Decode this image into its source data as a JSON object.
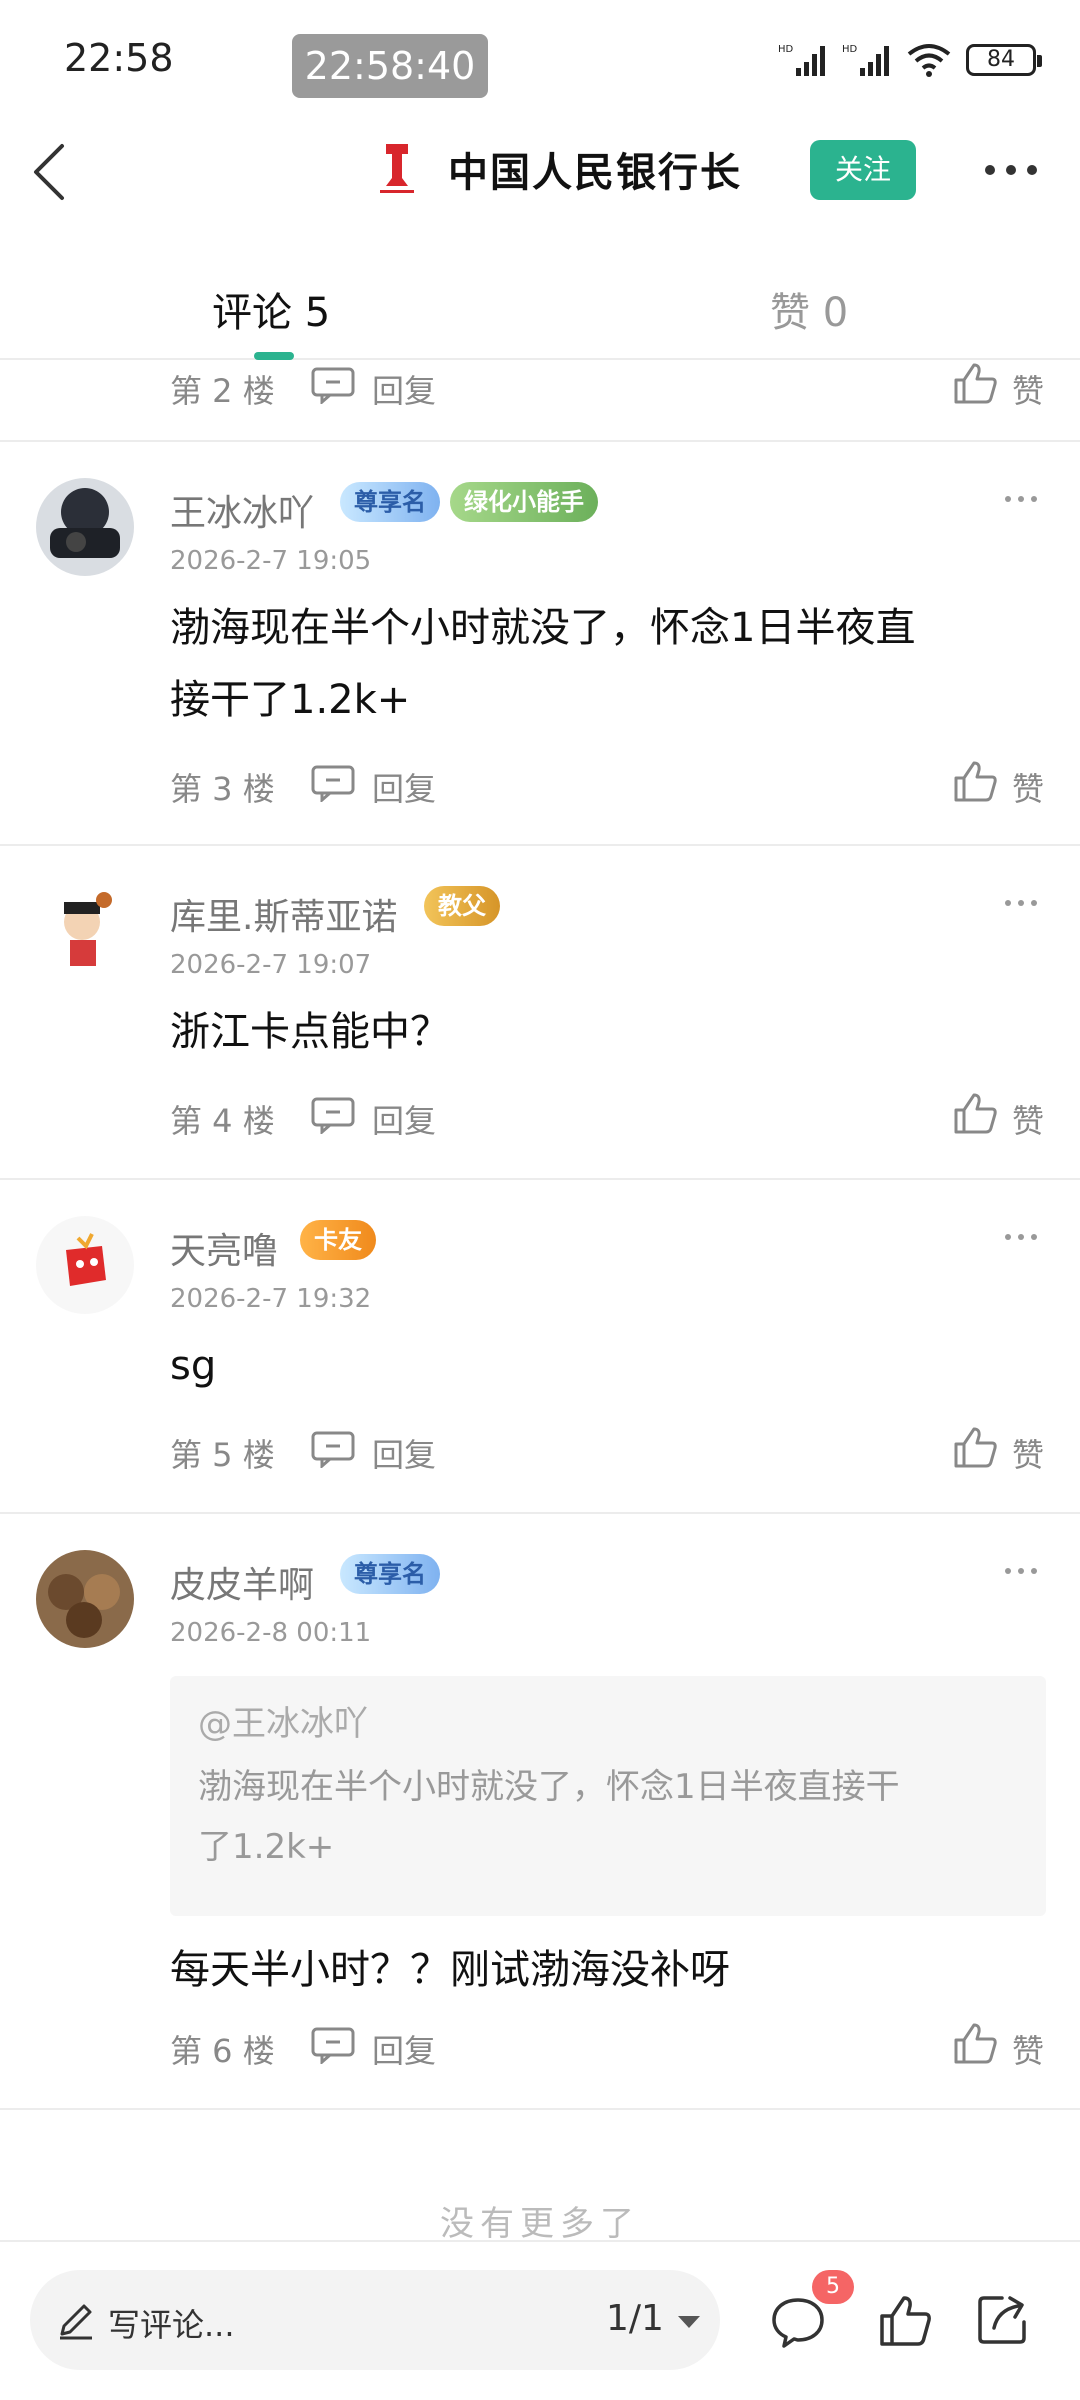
{
  "status_bar": {
    "time": "22:58",
    "recording_time": "22:58:40",
    "battery": "84"
  },
  "header": {
    "title": "中国人民银行长",
    "follow_label": "关注"
  },
  "tabs": {
    "comments_label": "评论 5",
    "likes_label": "赞 0"
  },
  "labels": {
    "reply": "回复",
    "like": "赞"
  },
  "previous_floor": {
    "floor": "第 2 楼"
  },
  "comments": [
    {
      "username": "王冰冰吖",
      "badges": [
        "尊享名",
        "绿化小能手"
      ],
      "time": "2026-2-7 19:05",
      "text_line1": "渤海现在半个小时就没了，怀念1日半夜直",
      "text_line2": "接干了1.2k+",
      "floor": "第 3 楼"
    },
    {
      "username": "库里.斯蒂亚诺",
      "badges": [
        "教父"
      ],
      "time": "2026-2-7 19:07",
      "text_line1": "浙江卡点能中？",
      "floor": "第 4 楼"
    },
    {
      "username": "天亮噜",
      "badges": [
        "卡友"
      ],
      "time": "2026-2-7 19:32",
      "text_line1": "sg",
      "floor": "第 5 楼"
    },
    {
      "username": "皮皮羊啊",
      "badges": [
        "尊享名"
      ],
      "time": "2026-2-8 00:11",
      "quote_user": "@王冰冰吖",
      "quote_line1": "渤海现在半个小时就没了，怀念1日半夜直接干",
      "quote_line2": "了1.2k+",
      "text_line1": "每天半小时？？刚试渤海没补呀",
      "floor": "第 6 楼"
    }
  ],
  "footer": {
    "no_more": "没有更多了"
  },
  "bottom_bar": {
    "write_placeholder": "写评论...",
    "page": "1/1",
    "comment_count": "5"
  },
  "colors": {
    "accent": "#2bb38f",
    "badge_red": "#f56565"
  }
}
